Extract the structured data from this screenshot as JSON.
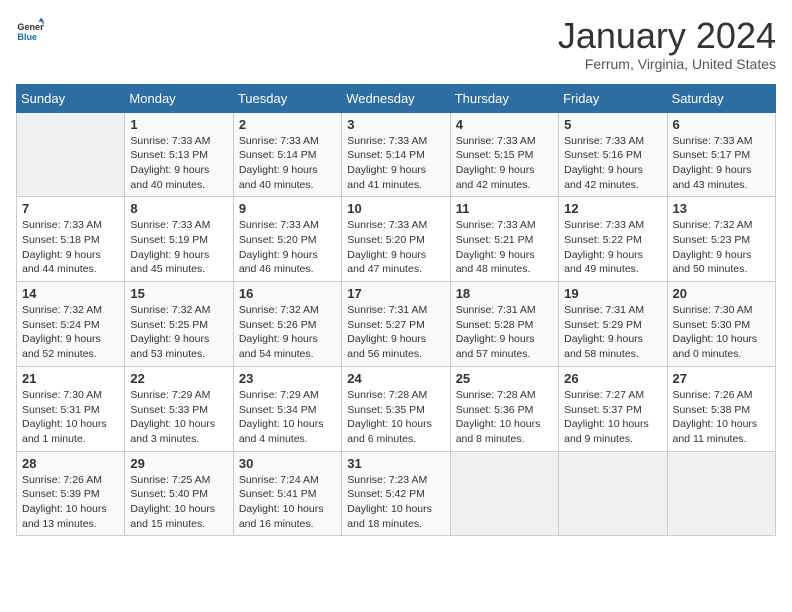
{
  "logo": {
    "text_general": "General",
    "text_blue": "Blue"
  },
  "header": {
    "month_year": "January 2024",
    "location": "Ferrum, Virginia, United States"
  },
  "days_of_week": [
    "Sunday",
    "Monday",
    "Tuesday",
    "Wednesday",
    "Thursday",
    "Friday",
    "Saturday"
  ],
  "weeks": [
    [
      {
        "day": "",
        "info": ""
      },
      {
        "day": "1",
        "info": "Sunrise: 7:33 AM\nSunset: 5:13 PM\nDaylight: 9 hours\nand 40 minutes."
      },
      {
        "day": "2",
        "info": "Sunrise: 7:33 AM\nSunset: 5:14 PM\nDaylight: 9 hours\nand 40 minutes."
      },
      {
        "day": "3",
        "info": "Sunrise: 7:33 AM\nSunset: 5:14 PM\nDaylight: 9 hours\nand 41 minutes."
      },
      {
        "day": "4",
        "info": "Sunrise: 7:33 AM\nSunset: 5:15 PM\nDaylight: 9 hours\nand 42 minutes."
      },
      {
        "day": "5",
        "info": "Sunrise: 7:33 AM\nSunset: 5:16 PM\nDaylight: 9 hours\nand 42 minutes."
      },
      {
        "day": "6",
        "info": "Sunrise: 7:33 AM\nSunset: 5:17 PM\nDaylight: 9 hours\nand 43 minutes."
      }
    ],
    [
      {
        "day": "7",
        "info": "Sunrise: 7:33 AM\nSunset: 5:18 PM\nDaylight: 9 hours\nand 44 minutes."
      },
      {
        "day": "8",
        "info": "Sunrise: 7:33 AM\nSunset: 5:19 PM\nDaylight: 9 hours\nand 45 minutes."
      },
      {
        "day": "9",
        "info": "Sunrise: 7:33 AM\nSunset: 5:20 PM\nDaylight: 9 hours\nand 46 minutes."
      },
      {
        "day": "10",
        "info": "Sunrise: 7:33 AM\nSunset: 5:20 PM\nDaylight: 9 hours\nand 47 minutes."
      },
      {
        "day": "11",
        "info": "Sunrise: 7:33 AM\nSunset: 5:21 PM\nDaylight: 9 hours\nand 48 minutes."
      },
      {
        "day": "12",
        "info": "Sunrise: 7:33 AM\nSunset: 5:22 PM\nDaylight: 9 hours\nand 49 minutes."
      },
      {
        "day": "13",
        "info": "Sunrise: 7:32 AM\nSunset: 5:23 PM\nDaylight: 9 hours\nand 50 minutes."
      }
    ],
    [
      {
        "day": "14",
        "info": "Sunrise: 7:32 AM\nSunset: 5:24 PM\nDaylight: 9 hours\nand 52 minutes."
      },
      {
        "day": "15",
        "info": "Sunrise: 7:32 AM\nSunset: 5:25 PM\nDaylight: 9 hours\nand 53 minutes."
      },
      {
        "day": "16",
        "info": "Sunrise: 7:32 AM\nSunset: 5:26 PM\nDaylight: 9 hours\nand 54 minutes."
      },
      {
        "day": "17",
        "info": "Sunrise: 7:31 AM\nSunset: 5:27 PM\nDaylight: 9 hours\nand 56 minutes."
      },
      {
        "day": "18",
        "info": "Sunrise: 7:31 AM\nSunset: 5:28 PM\nDaylight: 9 hours\nand 57 minutes."
      },
      {
        "day": "19",
        "info": "Sunrise: 7:31 AM\nSunset: 5:29 PM\nDaylight: 9 hours\nand 58 minutes."
      },
      {
        "day": "20",
        "info": "Sunrise: 7:30 AM\nSunset: 5:30 PM\nDaylight: 10 hours\nand 0 minutes."
      }
    ],
    [
      {
        "day": "21",
        "info": "Sunrise: 7:30 AM\nSunset: 5:31 PM\nDaylight: 10 hours\nand 1 minute."
      },
      {
        "day": "22",
        "info": "Sunrise: 7:29 AM\nSunset: 5:33 PM\nDaylight: 10 hours\nand 3 minutes."
      },
      {
        "day": "23",
        "info": "Sunrise: 7:29 AM\nSunset: 5:34 PM\nDaylight: 10 hours\nand 4 minutes."
      },
      {
        "day": "24",
        "info": "Sunrise: 7:28 AM\nSunset: 5:35 PM\nDaylight: 10 hours\nand 6 minutes."
      },
      {
        "day": "25",
        "info": "Sunrise: 7:28 AM\nSunset: 5:36 PM\nDaylight: 10 hours\nand 8 minutes."
      },
      {
        "day": "26",
        "info": "Sunrise: 7:27 AM\nSunset: 5:37 PM\nDaylight: 10 hours\nand 9 minutes."
      },
      {
        "day": "27",
        "info": "Sunrise: 7:26 AM\nSunset: 5:38 PM\nDaylight: 10 hours\nand 11 minutes."
      }
    ],
    [
      {
        "day": "28",
        "info": "Sunrise: 7:26 AM\nSunset: 5:39 PM\nDaylight: 10 hours\nand 13 minutes."
      },
      {
        "day": "29",
        "info": "Sunrise: 7:25 AM\nSunset: 5:40 PM\nDaylight: 10 hours\nand 15 minutes."
      },
      {
        "day": "30",
        "info": "Sunrise: 7:24 AM\nSunset: 5:41 PM\nDaylight: 10 hours\nand 16 minutes."
      },
      {
        "day": "31",
        "info": "Sunrise: 7:23 AM\nSunset: 5:42 PM\nDaylight: 10 hours\nand 18 minutes."
      },
      {
        "day": "",
        "info": ""
      },
      {
        "day": "",
        "info": ""
      },
      {
        "day": "",
        "info": ""
      }
    ]
  ]
}
